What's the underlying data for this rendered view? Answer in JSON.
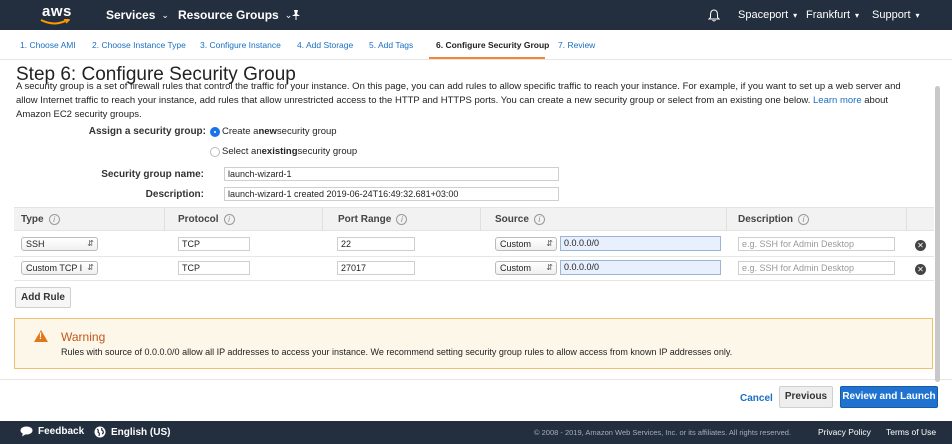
{
  "topnav": {
    "logo": "aws",
    "services": "Services",
    "resource_groups": "Resource Groups",
    "account": "Spaceport",
    "region": "Frankfurt",
    "support": "Support"
  },
  "tabs": [
    {
      "label": "1. Choose AMI"
    },
    {
      "label": "2. Choose Instance Type"
    },
    {
      "label": "3. Configure Instance"
    },
    {
      "label": "4. Add Storage"
    },
    {
      "label": "5. Add Tags"
    },
    {
      "label": "6. Configure Security Group"
    },
    {
      "label": "7. Review"
    }
  ],
  "page": {
    "title": "Step 6: Configure Security Group",
    "intro_text": "A security group is a set of firewall rules that control the traffic for your instance. On this page, you can add rules to allow specific traffic to reach your instance. For example, if you want to set up a web server and allow Internet traffic to reach your instance, add rules that allow unrestricted access to the HTTP and HTTPS ports. You can create a new security group or select from an existing one below.",
    "learn_more": "Learn more",
    "intro_tail": "about Amazon EC2 security groups."
  },
  "form": {
    "assign_label": "Assign a security group:",
    "option_new_prefix": "Create a ",
    "option_new_bold": "new",
    "option_new_suffix": " security group",
    "option_existing_prefix": "Select an ",
    "option_existing_bold": "existing",
    "option_existing_suffix": " security group",
    "name_label": "Security group name:",
    "name_value": "launch-wizard-1",
    "desc_label": "Description:",
    "desc_value": "launch-wizard-1 created 2019-06-24T16:49:32.681+03:00"
  },
  "table": {
    "headers": {
      "type": "Type",
      "protocol": "Protocol",
      "port_range": "Port Range",
      "source": "Source",
      "description": "Description"
    },
    "info_glyph": "i",
    "rows": [
      {
        "type": "SSH",
        "protocol": "TCP",
        "port": "22",
        "source_type": "Custom",
        "cidr": "0.0.0.0/0",
        "desc_placeholder": "e.g. SSH for Admin Desktop"
      },
      {
        "type": "Custom TCP I",
        "protocol": "TCP",
        "port": "27017",
        "source_type": "Custom",
        "cidr": "0.0.0.0/0",
        "desc_placeholder": "e.g. SSH for Admin Desktop"
      }
    ],
    "add_rule": "Add Rule"
  },
  "warning": {
    "title": "Warning",
    "text": "Rules with source of 0.0.0.0/0 allow all IP addresses to access your instance. We recommend setting security group rules to allow access from known IP addresses only."
  },
  "actions": {
    "cancel": "Cancel",
    "previous": "Previous",
    "review_launch": "Review and Launch"
  },
  "footer": {
    "feedback": "Feedback",
    "language": "English (US)",
    "copyright": "© 2008 - 2019, Amazon Web Services, Inc. or its affiliates. All rights reserved.",
    "privacy": "Privacy Policy",
    "terms": "Terms of Use"
  },
  "colors": {
    "nav_bg": "#232f3e",
    "link": "#1a6fc4",
    "accent_tab": "#f58536",
    "primary_button": "#1f72cf",
    "warning_border": "#f0c070",
    "warning_title": "#c4561a"
  }
}
